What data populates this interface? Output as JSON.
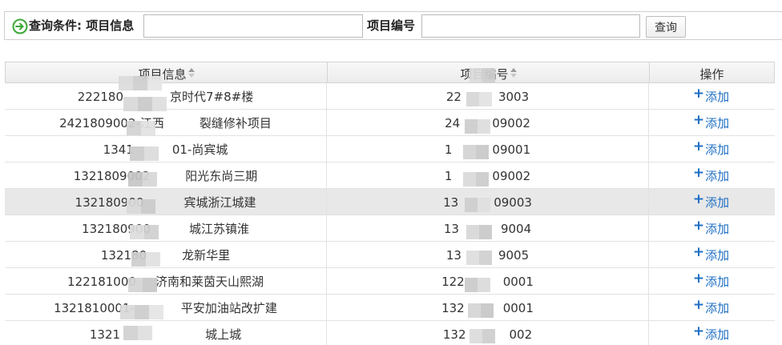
{
  "query": {
    "conditions_label": "查询条件: 项目信息",
    "project_info_value": "",
    "project_no_label": "项目编号",
    "project_no_value": "",
    "search_button": "查询"
  },
  "grid": {
    "columns": [
      {
        "label": "项目信息",
        "sortable": true
      },
      {
        "label": "项目编号",
        "sortable": true
      },
      {
        "label": "操作",
        "sortable": false
      }
    ],
    "rows": [
      {
        "info": "222180",
        "info2": "京时代7#8#楼",
        "no": "22",
        "no2": "3003",
        "action": "添加"
      },
      {
        "info": "2421809002-江西",
        "info2": "裂缝修补项目",
        "no": "24",
        "no2": "09002",
        "action": "添加"
      },
      {
        "info": "1341",
        "info2": "01-尚宾城",
        "no": "1",
        "no2": "09001",
        "action": "添加"
      },
      {
        "info": "1321809002",
        "info2": "阳光东尚三期",
        "no": "1",
        "no2": "09002",
        "action": "添加"
      },
      {
        "info": "132180900",
        "info2": "宾城浙江城建",
        "no": "13",
        "no2": "09003",
        "action": "添加"
      },
      {
        "info": "132180900",
        "info2": "城江苏镇淮",
        "no": "13",
        "no2": "9004",
        "action": "添加"
      },
      {
        "info": "132180",
        "info2": "龙新华里",
        "no": "13",
        "no2": "9005",
        "action": "添加"
      },
      {
        "info": "122181000",
        "info2": "济南和莱茵天山熙湖",
        "no": "122",
        "no2": "0001",
        "action": "添加"
      },
      {
        "info": "1321810001-",
        "info2": "平安加油站改扩建",
        "no": "132",
        "no2": "0001",
        "action": "添加"
      },
      {
        "info": "1321",
        "info2": "城上城",
        "no": "132",
        "no2": "002",
        "action": "添加"
      }
    ],
    "selected_row_index": 4
  },
  "colors": {
    "link": "#1f6fc4",
    "icon_green": "#3aa935",
    "selected_row": "#e8e8e8"
  }
}
